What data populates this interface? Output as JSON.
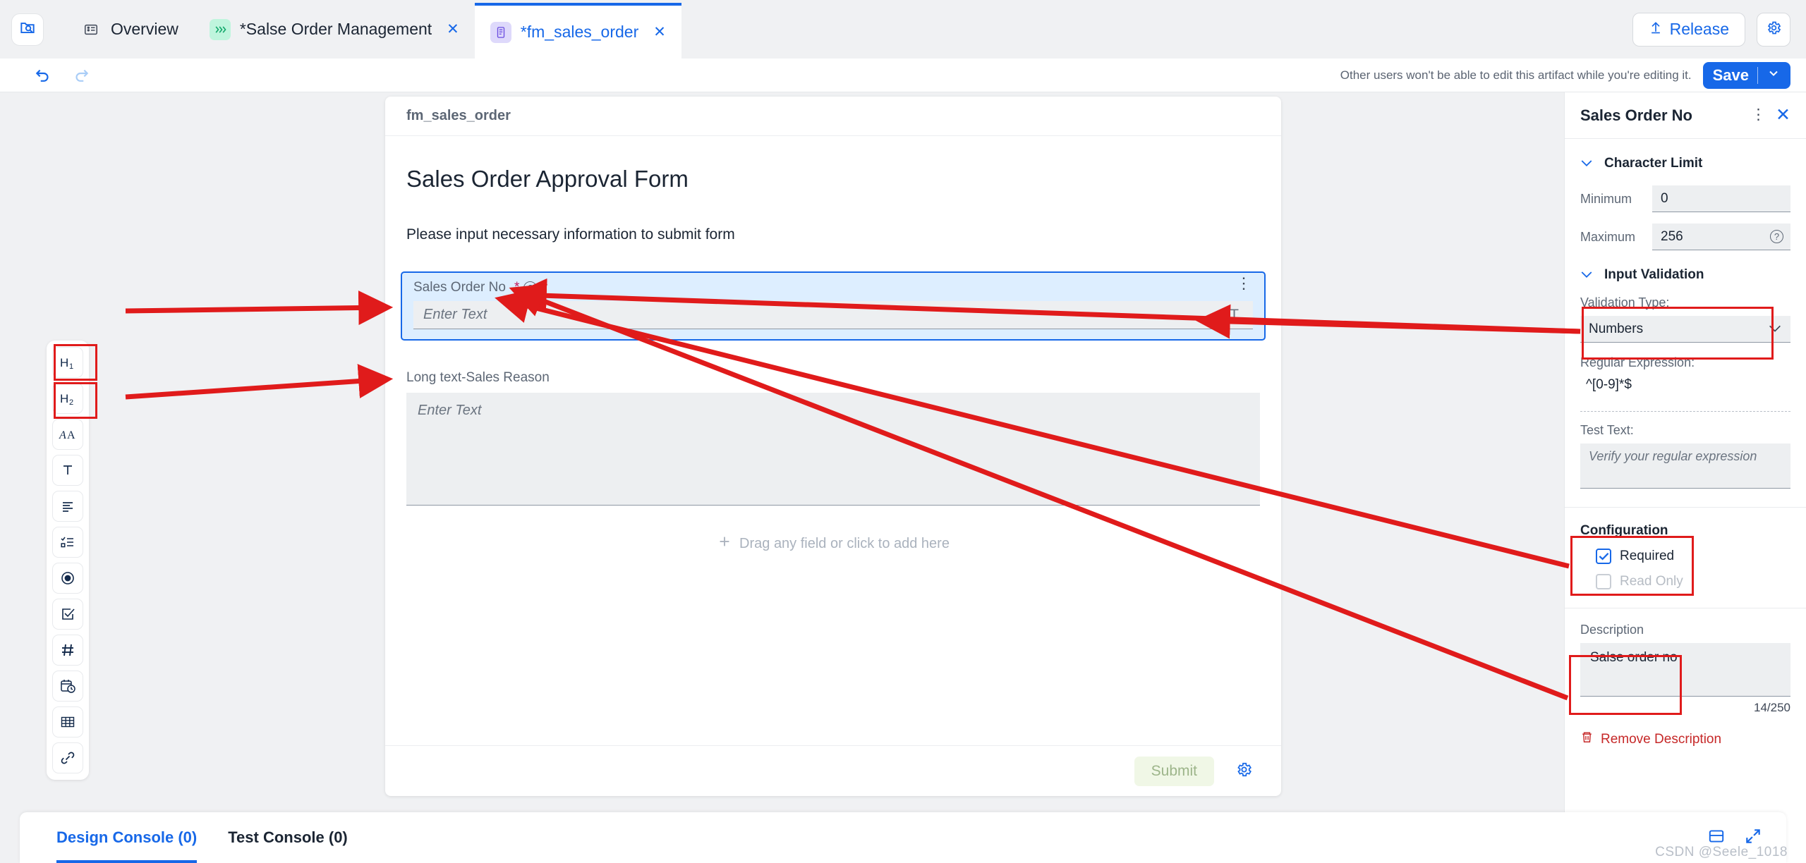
{
  "topbar": {
    "app_launcher_icon": "folder-search-icon",
    "tabs": [
      {
        "label": "Overview",
        "icon": "list-card-icon",
        "active": false,
        "closable": false
      },
      {
        "label": "*Salse Order Management",
        "icon": "chevrons-right-icon",
        "active": false,
        "closable": true
      },
      {
        "label": "*fm_sales_order",
        "icon": "form-icon",
        "active": true,
        "closable": true
      }
    ],
    "release_label": "Release",
    "release_icon": "upload-icon",
    "settings_icon": "gear-icon"
  },
  "actionbar": {
    "undo_icon": "undo-icon",
    "redo_icon": "redo-icon",
    "hint": "Other users won't be able to edit this artifact while you're editing it.",
    "save_label": "Save",
    "save_caret_icon": "chevron-down-icon"
  },
  "palette": {
    "items": [
      {
        "name": "heading-1",
        "glyph": "H₁"
      },
      {
        "name": "heading-2",
        "glyph": "H₂"
      },
      {
        "name": "rich-text",
        "glyph": "AA"
      },
      {
        "name": "single-line-text",
        "glyph": "T",
        "highlighted": true
      },
      {
        "name": "long-text",
        "glyph": "≡",
        "highlighted": true
      },
      {
        "name": "checklist",
        "glyph": "☑≡"
      },
      {
        "name": "radio-button",
        "glyph": "◉"
      },
      {
        "name": "checkbox",
        "glyph": "☑"
      },
      {
        "name": "number",
        "glyph": "#"
      },
      {
        "name": "date-time",
        "glyph": "📅"
      },
      {
        "name": "table",
        "glyph": "▦"
      },
      {
        "name": "link",
        "glyph": "🔗"
      }
    ]
  },
  "form": {
    "breadcrumb": "fm_sales_order",
    "title": "Sales Order Approval Form",
    "subtitle": "Please input necessary information to submit form",
    "selected_field": {
      "label": "Sales Order No",
      "required_marker": "*",
      "help_icon": "question-circle-icon",
      "kebab_icon": "more-vertical-icon",
      "placeholder": "Enter Text",
      "type_icon": "T"
    },
    "long_field": {
      "label": "Long text-Sales Reason",
      "placeholder": "Enter Text"
    },
    "drop_hint": "Drag any field or click to add here",
    "drop_hint_icon": "plus-icon",
    "submit_label": "Submit",
    "settings_icon": "gear-icon"
  },
  "panel": {
    "title": "Sales Order No",
    "kebab_icon": "more-vertical-icon",
    "close_icon": "close-icon",
    "character_limit": {
      "section_label": "Character Limit",
      "minimum_label": "Minimum",
      "minimum_value": "0",
      "maximum_label": "Maximum",
      "maximum_value": "256",
      "maximum_help_icon": "question-circle-icon"
    },
    "input_validation": {
      "section_label": "Input Validation",
      "validation_type_label": "Validation Type:",
      "validation_type_value": "Numbers",
      "validation_type_caret": "chevron-down-icon",
      "regex_label": "Regular Expression:",
      "regex_value": "^[0-9]*$",
      "test_text_label": "Test Text:",
      "test_text_placeholder": "Verify your regular expression"
    },
    "configuration": {
      "section_label": "Configuration",
      "required_label": "Required",
      "required_checked": true,
      "read_only_label": "Read Only",
      "read_only_checked": false
    },
    "description": {
      "label": "Description",
      "value": "Salse order no",
      "counter": "14/250",
      "remove_label": "Remove Description",
      "remove_icon": "trash-icon"
    }
  },
  "console": {
    "tabs": [
      {
        "label": "Design Console (0)",
        "active": true
      },
      {
        "label": "Test Console (0)",
        "active": false
      }
    ],
    "panel_icon": "panel-bottom-icon",
    "expand_icon": "expand-icon"
  },
  "watermark": "CSDN @Seele_1018",
  "colors": {
    "accent": "#1768e8",
    "annotation": "#e01b1b",
    "selected_field_bg": "#ddeeff",
    "danger": "#c62828"
  }
}
